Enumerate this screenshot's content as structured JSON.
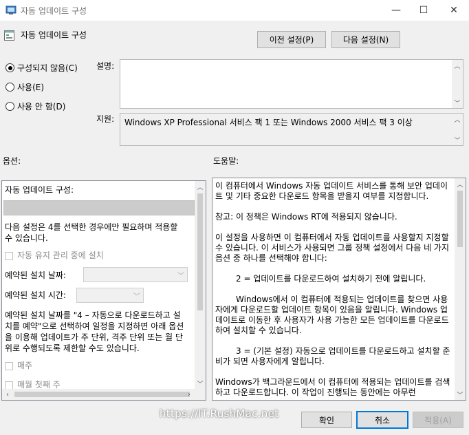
{
  "window": {
    "title": "자동 업데이트 구성",
    "minimize_glyph": "—",
    "maximize_glyph": "☐",
    "close_glyph": "✕"
  },
  "header": {
    "policy_title": "자동 업데이트 구성",
    "prev_button": "이전 설정(P)",
    "next_button": "다음 설정(N)"
  },
  "state": {
    "options": [
      {
        "label": "구성되지 않음(C)",
        "checked": true
      },
      {
        "label": "사용(E)",
        "checked": false
      },
      {
        "label": "사용 안 함(D)",
        "checked": false
      }
    ]
  },
  "comment": {
    "label": "설명:",
    "value": ""
  },
  "supported": {
    "label": "지원:",
    "value": "Windows XP Professional 서비스 팩 1 또는 Windows 2000 서비스 팩 3 이상"
  },
  "options_section": {
    "label": "옵션:",
    "configure_label": "자동 업데이트 구성:",
    "configure_value": "",
    "note_line1": "다음 설정은 4를 선택한 경우에만 필요하며 적용할",
    "note_line2": "수 있습니다.",
    "maintenance_install": "자동 유지 관리 중에 설치",
    "scheduled_day_label": "예약된 설치 날짜:",
    "scheduled_time_label": "예약된 설치 시간:",
    "desc_line1": "예약된 설치 날짜를 \"4 – 자동으로 다운로드하고 설",
    "desc_line2": "치를 예약\"으로 선택하여 일정을 지정하면 아래 옵션",
    "desc_line3": "을 이용해 업데이트가 주 단위, 격주 단위 또는 월 단",
    "desc_line4": "위로 수행되도록 제한할 수도 있습니다.",
    "weekly": "매주",
    "first_week": "매월 첫째 주"
  },
  "help_section": {
    "label": "도움말:",
    "p1": "이 컴퓨터에서 Windows 자동 업데이트 서비스를 통해 보안 업데이트 및 기타 중요한 다운로드 항목을 받을지 여부를 지정합니다.",
    "p2": "참고: 이 정책은 Windows RT에 적용되지 않습니다.",
    "p3": "이 설정을 사용하면 이 컴퓨터에서 자동 업데이트를 사용할지 지정할 수 있습니다. 이 서비스가 사용되면 그룹 정책 설정에서 다음 네 가지 옵션 중 하나를 선택해야 합니다:",
    "p4": "2 = 업데이트를 다운로드하여 설치하기 전에 알립니다.",
    "p5": "Windows에서 이 컴퓨터에 적용되는 업데이트를 찾으면 사용자에게 다운로드할 업데이트 항목이 있음을 알립니다. Windows 업데이트로 이동한 후 사용자가 사용 가능한 모든 업데이트를 다운로드하여 설치할 수 있습니다.",
    "p6": "3 = (기본 설정) 자동으로 업데이트를 다운로드하고 설치할 준비가 되면 사용자에게 알립니다.",
    "p7": "Windows가 백그라운드에서 이 컴퓨터에 적용되는 업데이트를 검색하고 다운로드합니다. 이 작업이 진행되는 동안에는 아무런"
  },
  "footer": {
    "ok_button": "확인",
    "cancel_button": "취소",
    "apply_button": "적용(A)",
    "watermark": "https://IT.RushMac.net"
  },
  "colors": {
    "accent": "#0078d7",
    "window_bg": "#f0f0f0",
    "panel_border": "#828790"
  }
}
